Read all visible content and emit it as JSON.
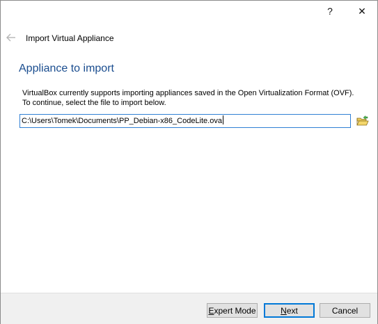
{
  "titlebar": {
    "help_label": "?",
    "close_label": "✕"
  },
  "header": {
    "back_icon": "back-arrow-icon",
    "title": "Import Virtual Appliance"
  },
  "page": {
    "heading": "Appliance to import",
    "description": "VirtualBox currently supports importing appliances saved in the Open Virtualization Format (OVF). To continue, select the file to import below."
  },
  "file_selector": {
    "value": "C:\\Users\\Tomek\\Documents\\PP_Debian-x86_CodeLite.ova",
    "browse_icon": "folder-open-icon"
  },
  "buttons": {
    "expert_first": "E",
    "expert_rest": "xpert Mode",
    "next_first": "N",
    "next_rest": "ext",
    "cancel": "Cancel"
  },
  "colors": {
    "heading": "#1a4d8f",
    "input_focus_border": "#2f7fd4",
    "default_button_border": "#0078d7",
    "footer_bg": "#f0f0f0"
  }
}
